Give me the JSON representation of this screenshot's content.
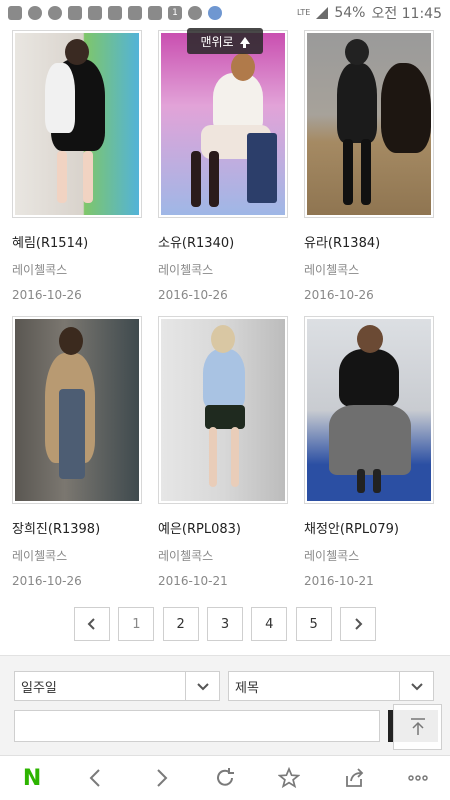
{
  "status_bar": {
    "battery": "54%",
    "time": "오전 11:45",
    "network": "LTE",
    "notification_count": "1"
  },
  "back_to_top": {
    "label": "맨위로"
  },
  "items": [
    {
      "title": "혜림(R1514)",
      "brand": "레이첼콕스",
      "date": "2016-10-26"
    },
    {
      "title": "소유(R1340)",
      "brand": "레이첼콕스",
      "date": "2016-10-26"
    },
    {
      "title": "유라(R1384)",
      "brand": "레이첼콕스",
      "date": "2016-10-26"
    },
    {
      "title": "장희진(R1398)",
      "brand": "레이첼콕스",
      "date": "2016-10-26"
    },
    {
      "title": "예은(RPL083)",
      "brand": "레이첼콕스",
      "date": "2016-10-21"
    },
    {
      "title": "채정안(RPL079)",
      "brand": "레이첼콕스",
      "date": "2016-10-21"
    }
  ],
  "pagination": {
    "pages": [
      "1",
      "2",
      "3",
      "4",
      "5"
    ],
    "current": "1"
  },
  "search": {
    "period_selected": "일주일",
    "field_selected": "제목",
    "query_value": ""
  },
  "colors": {
    "naver_green": "#2db400",
    "border": "#cfcfcf",
    "muted_text": "#888888"
  }
}
